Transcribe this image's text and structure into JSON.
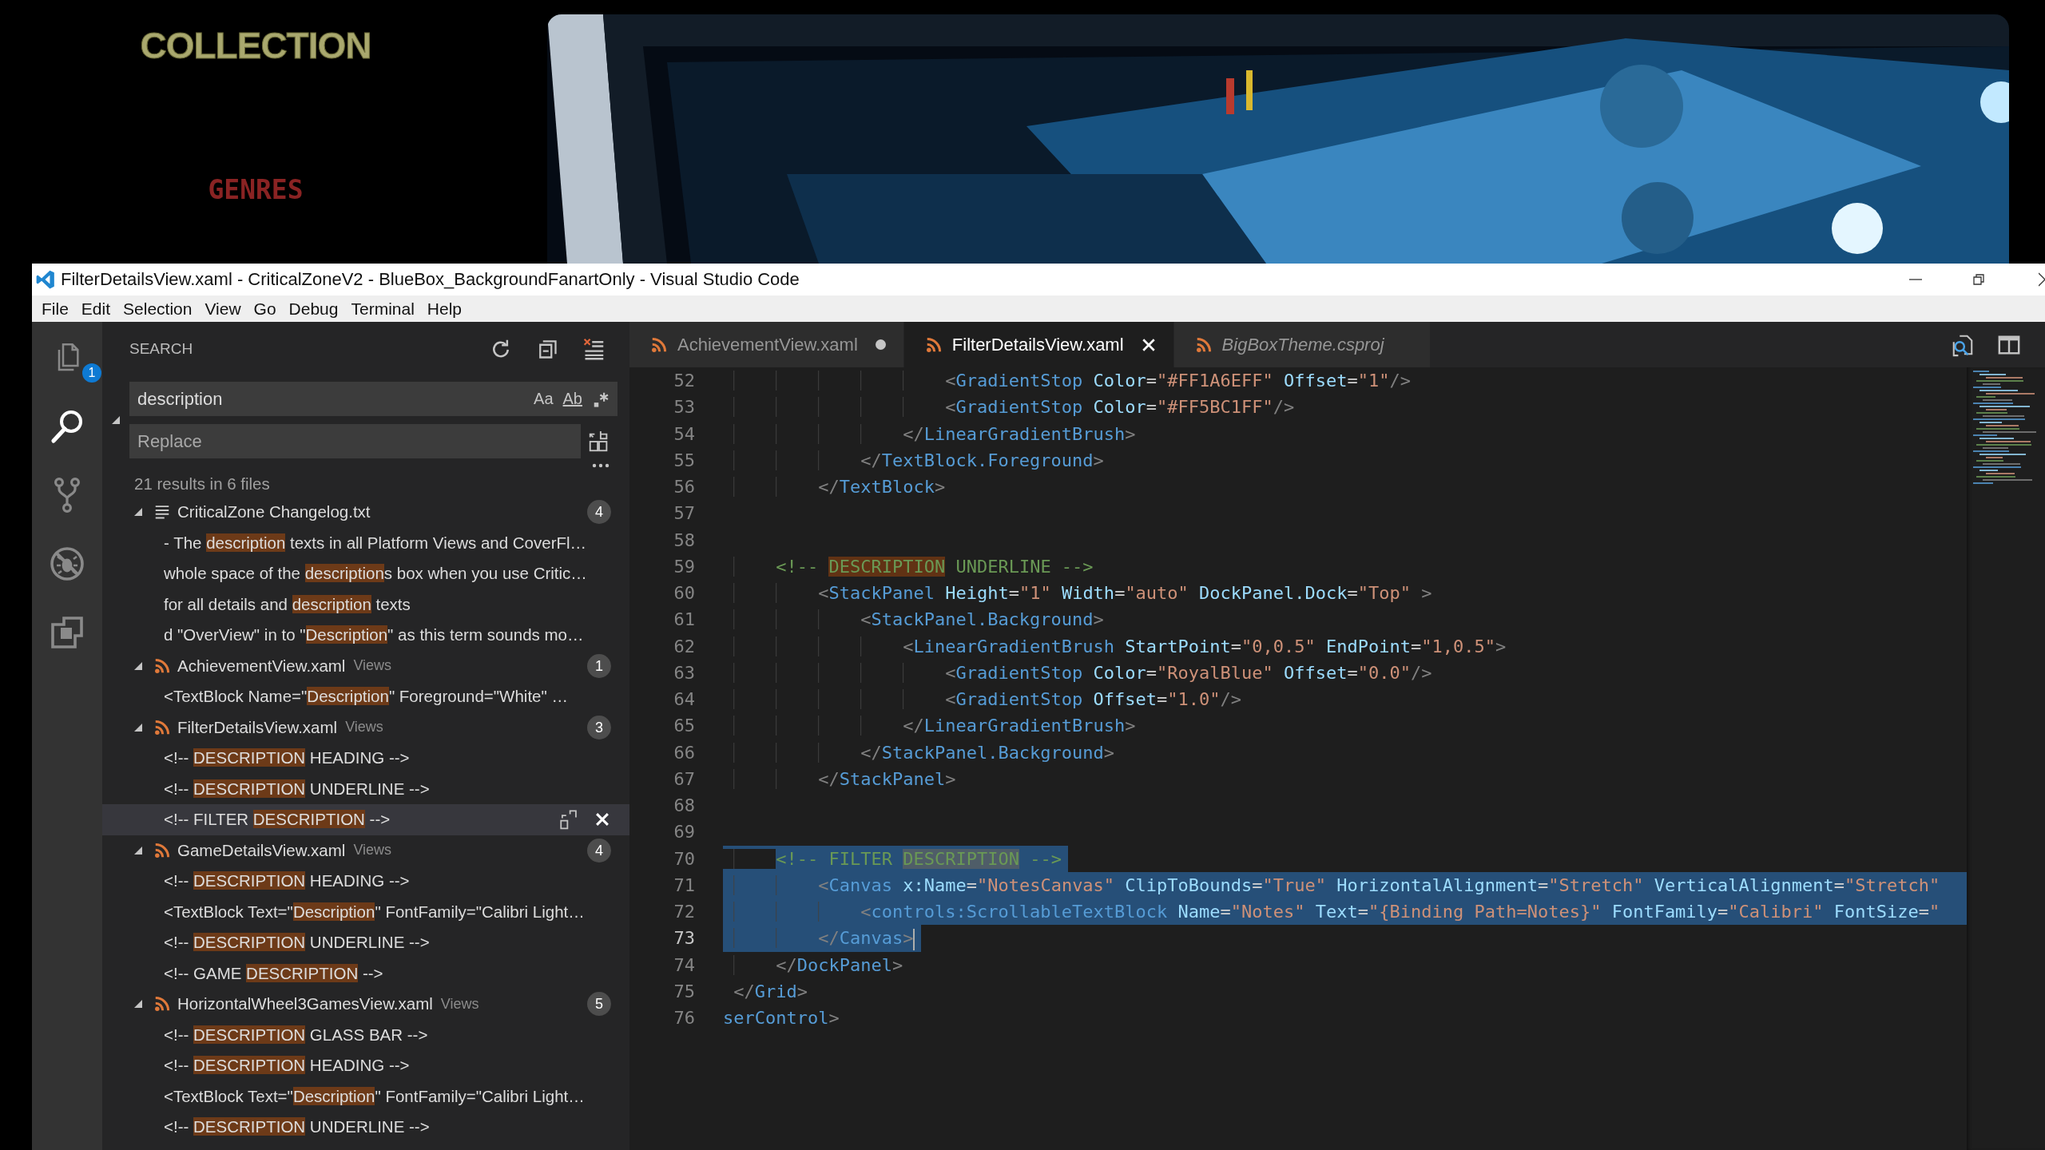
{
  "backdrop": {
    "title": "COLLECTION",
    "subtitle": "GENRES"
  },
  "window": {
    "title": "FilterDetailsView.xaml - CriticalZoneV2 - BlueBox_BackgroundFanartOnly - Visual Studio Code"
  },
  "menu": [
    "File",
    "Edit",
    "Selection",
    "View",
    "Go",
    "Debug",
    "Terminal",
    "Help"
  ],
  "activity_bar": [
    {
      "kind": "explorer",
      "selected": false,
      "badge": "1"
    },
    {
      "kind": "search",
      "selected": true
    },
    {
      "kind": "source-control",
      "selected": false
    },
    {
      "kind": "debug",
      "selected": false
    },
    {
      "kind": "extensions",
      "selected": false
    }
  ],
  "search_panel": {
    "title": "SEARCH",
    "query": "description",
    "match_case": "Aa",
    "whole_word": "Ab",
    "replace_placeholder": "Replace",
    "replace_expanded": true,
    "summary": "21 results in 6 files",
    "files": [
      {
        "name": "CriticalZone Changelog.txt",
        "kind": "text",
        "expanded": true,
        "count": "4",
        "matches": [
          {
            "before": "- The ",
            "match": "description",
            "after": " texts in all Platform Views and CoverFl…",
            "selected": false
          },
          {
            "before": "whole space of the ",
            "match": "description",
            "after": "s box when you use Critic…",
            "selected": false
          },
          {
            "before": "for all details and ",
            "match": "description",
            "after": " texts",
            "selected": false
          },
          {
            "before": "d \"OverView\" in to \"",
            "match": "Description",
            "after": "\" as this term sounds mo…",
            "selected": false
          }
        ]
      },
      {
        "name": "AchievementView.xaml",
        "folder": "Views",
        "kind": "xml",
        "expanded": true,
        "count": "1",
        "matches": [
          {
            "before": "<TextBlock Name=\"",
            "match": "Description",
            "after": "\" Foreground=\"White\" …",
            "selected": false
          }
        ]
      },
      {
        "name": "FilterDetailsView.xaml",
        "folder": "Views",
        "kind": "xml",
        "expanded": true,
        "count": "3",
        "matches": [
          {
            "before": "<!-- ",
            "match": "DESCRIPTION",
            "after": " HEADING -->",
            "selected": false
          },
          {
            "before": "<!-- ",
            "match": "DESCRIPTION",
            "after": " UNDERLINE -->",
            "selected": false
          },
          {
            "before": "<!-- FILTER ",
            "match": "DESCRIPTION",
            "after": " -->",
            "selected": true
          }
        ]
      },
      {
        "name": "GameDetailsView.xaml",
        "folder": "Views",
        "kind": "xml",
        "expanded": true,
        "count": "4",
        "matches": [
          {
            "before": "<!-- ",
            "match": "DESCRIPTION",
            "after": " HEADING -->",
            "selected": false
          },
          {
            "before": "<TextBlock Text=\"",
            "match": "Description",
            "after": "\" FontFamily=\"Calibri Light…",
            "selected": false
          },
          {
            "before": "<!-- ",
            "match": "DESCRIPTION",
            "after": " UNDERLINE -->",
            "selected": false
          },
          {
            "before": "<!-- GAME ",
            "match": "DESCRIPTION",
            "after": " -->",
            "selected": false
          }
        ]
      },
      {
        "name": "HorizontalWheel3GamesView.xaml",
        "folder": "Views",
        "kind": "xml",
        "expanded": true,
        "count": "5",
        "matches": [
          {
            "before": "<!-- ",
            "match": "DESCRIPTION",
            "after": " GLASS BAR -->",
            "selected": false
          },
          {
            "before": "<!-- ",
            "match": "DESCRIPTION",
            "after": " HEADING -->",
            "selected": false
          },
          {
            "before": "<TextBlock Text=\"",
            "match": "Description",
            "after": "\" FontFamily=\"Calibri Light…",
            "selected": false
          },
          {
            "before": "<!-- ",
            "match": "DESCRIPTION",
            "after": " UNDERLINE -->",
            "selected": false
          }
        ]
      }
    ]
  },
  "editor": {
    "tabs": [
      {
        "label": "AchievementView.xaml",
        "selected": false,
        "dirty": true,
        "preview": false
      },
      {
        "label": "FilterDetailsView.xaml",
        "selected": true,
        "dirty": false,
        "preview": false
      },
      {
        "label": "BigBoxTheme.csproj",
        "selected": false,
        "dirty": false,
        "preview": true
      }
    ],
    "lines": [
      {
        "number": "52",
        "selected": false,
        "cursor": false,
        "tokens": [
          {
            "kind": "punct",
            "text": "                     <"
          },
          {
            "kind": "tag",
            "text": "GradientStop"
          },
          {
            "kind": "attr",
            "text": " Color"
          },
          {
            "kind": "plain",
            "text": "="
          },
          {
            "kind": "str",
            "text": "\"#FF1A6EFF\""
          },
          {
            "kind": "attr",
            "text": " Offset"
          },
          {
            "kind": "plain",
            "text": "="
          },
          {
            "kind": "str",
            "text": "\"1\""
          },
          {
            "kind": "punct",
            "text": "/>"
          }
        ]
      },
      {
        "number": "53",
        "selected": false,
        "cursor": false,
        "tokens": [
          {
            "kind": "punct",
            "text": "                     <"
          },
          {
            "kind": "tag",
            "text": "GradientStop"
          },
          {
            "kind": "attr",
            "text": " Color"
          },
          {
            "kind": "plain",
            "text": "="
          },
          {
            "kind": "str",
            "text": "\"#FF5BC1FF\""
          },
          {
            "kind": "punct",
            "text": "/>"
          }
        ]
      },
      {
        "number": "54",
        "selected": false,
        "cursor": false,
        "tokens": [
          {
            "kind": "punct",
            "text": "                 </"
          },
          {
            "kind": "tag",
            "text": "LinearGradientBrush"
          },
          {
            "kind": "punct",
            "text": ">"
          }
        ]
      },
      {
        "number": "55",
        "selected": false,
        "cursor": false,
        "tokens": [
          {
            "kind": "punct",
            "text": "             </"
          },
          {
            "kind": "tag",
            "text": "TextBlock.Foreground"
          },
          {
            "kind": "punct",
            "text": ">"
          }
        ]
      },
      {
        "number": "56",
        "selected": false,
        "cursor": false,
        "tokens": [
          {
            "kind": "punct",
            "text": "         </"
          },
          {
            "kind": "tag",
            "text": "TextBlock"
          },
          {
            "kind": "punct",
            "text": ">"
          }
        ]
      },
      {
        "number": "57",
        "selected": false,
        "cursor": false
      },
      {
        "number": "58",
        "selected": false,
        "cursor": false
      },
      {
        "number": "59",
        "selected": false,
        "cursor": false,
        "tokens": [
          {
            "kind": "comment",
            "text": "     <!-- "
          },
          {
            "kind": "match",
            "text": "DESCRIPTION"
          },
          {
            "kind": "comment",
            "text": " UNDERLINE -->"
          }
        ]
      },
      {
        "number": "60",
        "selected": false,
        "cursor": false,
        "tokens": [
          {
            "kind": "punct",
            "text": "         <"
          },
          {
            "kind": "tag",
            "text": "StackPanel"
          },
          {
            "kind": "attr",
            "text": " Height"
          },
          {
            "kind": "plain",
            "text": "="
          },
          {
            "kind": "str",
            "text": "\"1\""
          },
          {
            "kind": "attr",
            "text": " Width"
          },
          {
            "kind": "plain",
            "text": "="
          },
          {
            "kind": "str",
            "text": "\"auto\""
          },
          {
            "kind": "attr",
            "text": " DockPanel.Dock"
          },
          {
            "kind": "plain",
            "text": "="
          },
          {
            "kind": "str",
            "text": "\"Top\""
          },
          {
            "kind": "punct",
            "text": " >"
          }
        ]
      },
      {
        "number": "61",
        "selected": false,
        "cursor": false,
        "tokens": [
          {
            "kind": "punct",
            "text": "             <"
          },
          {
            "kind": "tag",
            "text": "StackPanel.Background"
          },
          {
            "kind": "punct",
            "text": ">"
          }
        ]
      },
      {
        "number": "62",
        "selected": false,
        "cursor": false,
        "tokens": [
          {
            "kind": "punct",
            "text": "                 <"
          },
          {
            "kind": "tag",
            "text": "LinearGradientBrush"
          },
          {
            "kind": "attr",
            "text": " StartPoint"
          },
          {
            "kind": "plain",
            "text": "="
          },
          {
            "kind": "str",
            "text": "\"0,0.5\""
          },
          {
            "kind": "attr",
            "text": " EndPoint"
          },
          {
            "kind": "plain",
            "text": "="
          },
          {
            "kind": "str",
            "text": "\"1,0.5\""
          },
          {
            "kind": "punct",
            "text": ">"
          }
        ]
      },
      {
        "number": "63",
        "selected": false,
        "cursor": false,
        "tokens": [
          {
            "kind": "punct",
            "text": "                     <"
          },
          {
            "kind": "tag",
            "text": "GradientStop"
          },
          {
            "kind": "attr",
            "text": " Color"
          },
          {
            "kind": "plain",
            "text": "="
          },
          {
            "kind": "str",
            "text": "\"RoyalBlue\""
          },
          {
            "kind": "attr",
            "text": " Offset"
          },
          {
            "kind": "plain",
            "text": "="
          },
          {
            "kind": "str",
            "text": "\"0.0\""
          },
          {
            "kind": "punct",
            "text": "/>"
          }
        ]
      },
      {
        "number": "64",
        "selected": false,
        "cursor": false,
        "tokens": [
          {
            "kind": "punct",
            "text": "                     <"
          },
          {
            "kind": "tag",
            "text": "GradientStop"
          },
          {
            "kind": "attr",
            "text": " Offset"
          },
          {
            "kind": "plain",
            "text": "="
          },
          {
            "kind": "str",
            "text": "\"1.0\""
          },
          {
            "kind": "punct",
            "text": "/>"
          }
        ]
      },
      {
        "number": "65",
        "selected": false,
        "cursor": false,
        "tokens": [
          {
            "kind": "punct",
            "text": "                 </"
          },
          {
            "kind": "tag",
            "text": "LinearGradientBrush"
          },
          {
            "kind": "punct",
            "text": ">"
          }
        ]
      },
      {
        "number": "66",
        "selected": false,
        "cursor": false,
        "tokens": [
          {
            "kind": "punct",
            "text": "             </"
          },
          {
            "kind": "tag",
            "text": "StackPanel.Background"
          },
          {
            "kind": "punct",
            "text": ">"
          }
        ]
      },
      {
        "number": "67",
        "selected": false,
        "cursor": false,
        "tokens": [
          {
            "kind": "punct",
            "text": "         </"
          },
          {
            "kind": "tag",
            "text": "StackPanel"
          },
          {
            "kind": "punct",
            "text": ">"
          }
        ]
      },
      {
        "number": "68",
        "selected": false,
        "cursor": false
      },
      {
        "number": "69",
        "selected": false,
        "cursor": false
      },
      {
        "number": "70",
        "selected": true,
        "cursor": false,
        "tokens": [
          {
            "kind": "comment",
            "text": "     <!-- FILTER "
          },
          {
            "kind": "match",
            "text": "DESCRIPTION"
          },
          {
            "kind": "comment",
            "text": " -->"
          }
        ]
      },
      {
        "number": "71",
        "selected": true,
        "cursor": false,
        "tokens": [
          {
            "kind": "punct",
            "text": "         <"
          },
          {
            "kind": "tag",
            "text": "Canvas"
          },
          {
            "kind": "attr",
            "text": " x:Name"
          },
          {
            "kind": "plain",
            "text": "="
          },
          {
            "kind": "str",
            "text": "\"NotesCanvas\""
          },
          {
            "kind": "attr",
            "text": " ClipToBounds"
          },
          {
            "kind": "plain",
            "text": "="
          },
          {
            "kind": "str",
            "text": "\"True\""
          },
          {
            "kind": "attr",
            "text": " HorizontalAlignment"
          },
          {
            "kind": "plain",
            "text": "="
          },
          {
            "kind": "str",
            "text": "\"Stretch\""
          },
          {
            "kind": "attr",
            "text": " VerticalAlignment"
          },
          {
            "kind": "plain",
            "text": "="
          },
          {
            "kind": "str",
            "text": "\"Stretch\""
          }
        ]
      },
      {
        "number": "72",
        "selected": true,
        "cursor": false,
        "tokens": [
          {
            "kind": "punct",
            "text": "             <"
          },
          {
            "kind": "tag",
            "text": "controls:ScrollableTextBlock"
          },
          {
            "kind": "attr",
            "text": " Name"
          },
          {
            "kind": "plain",
            "text": "="
          },
          {
            "kind": "str",
            "text": "\"Notes\""
          },
          {
            "kind": "attr",
            "text": " Text"
          },
          {
            "kind": "plain",
            "text": "="
          },
          {
            "kind": "str",
            "text": "\"{Binding Path=Notes}\""
          },
          {
            "kind": "attr",
            "text": " FontFamily"
          },
          {
            "kind": "plain",
            "text": "="
          },
          {
            "kind": "str",
            "text": "\"Calibri\""
          },
          {
            "kind": "attr",
            "text": " FontSize"
          },
          {
            "kind": "plain",
            "text": "="
          },
          {
            "kind": "str",
            "text": "\""
          }
        ]
      },
      {
        "number": "73",
        "selected": true,
        "cursor": true,
        "tokens": [
          {
            "kind": "punct",
            "text": "         </"
          },
          {
            "kind": "tag",
            "text": "Canvas"
          },
          {
            "kind": "punct",
            "text": ">"
          }
        ]
      },
      {
        "number": "74",
        "selected": false,
        "cursor": false,
        "tokens": [
          {
            "kind": "punct",
            "text": "     </"
          },
          {
            "kind": "tag",
            "text": "DockPanel"
          },
          {
            "kind": "punct",
            "text": ">"
          }
        ]
      },
      {
        "number": "75",
        "selected": false,
        "cursor": false,
        "tokens": [
          {
            "kind": "punct",
            "text": " </"
          },
          {
            "kind": "tag",
            "text": "Grid"
          },
          {
            "kind": "punct",
            "text": ">"
          }
        ]
      },
      {
        "number": "76",
        "selected": false,
        "cursor": false,
        "tokens": [
          {
            "kind": "tag",
            "text": "serControl"
          },
          {
            "kind": "punct",
            "text": ">"
          }
        ]
      }
    ]
  }
}
